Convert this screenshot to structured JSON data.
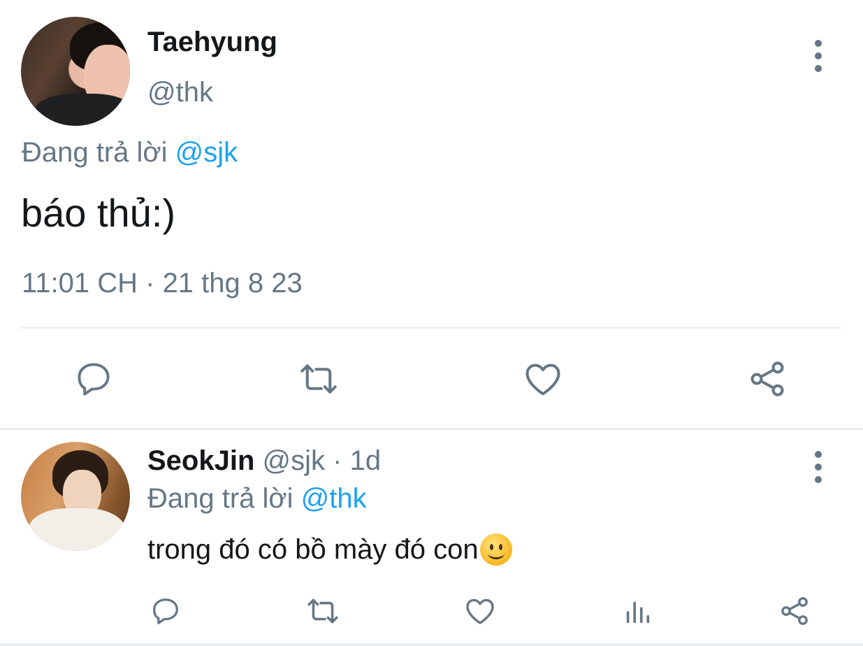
{
  "main_tweet": {
    "author_name": "Taehyung",
    "author_handle": "@thk",
    "replying_label": "Đang trả lời",
    "replying_to": "@sjk",
    "text": "báo thủ:)",
    "timestamp": "11:01 CH · 21 thg 8 23",
    "actions": [
      "reply-icon",
      "retweet-icon",
      "like-icon",
      "share-icon"
    ]
  },
  "reply_tweet": {
    "author_name": "SeokJin",
    "author_handle": "@sjk",
    "separator": "·",
    "age": "1d",
    "replying_label": "Đang trả lời",
    "replying_to": "@thk",
    "text": "trong đó có bồ mày đó con",
    "emoji": "slightly-smiling-face",
    "actions": [
      "reply-icon",
      "retweet-icon",
      "like-icon",
      "analytics-icon",
      "share-icon"
    ]
  },
  "colors": {
    "text": "#14171a",
    "muted": "#657786",
    "link": "#1da1f2",
    "divider": "#e6ecf0"
  }
}
